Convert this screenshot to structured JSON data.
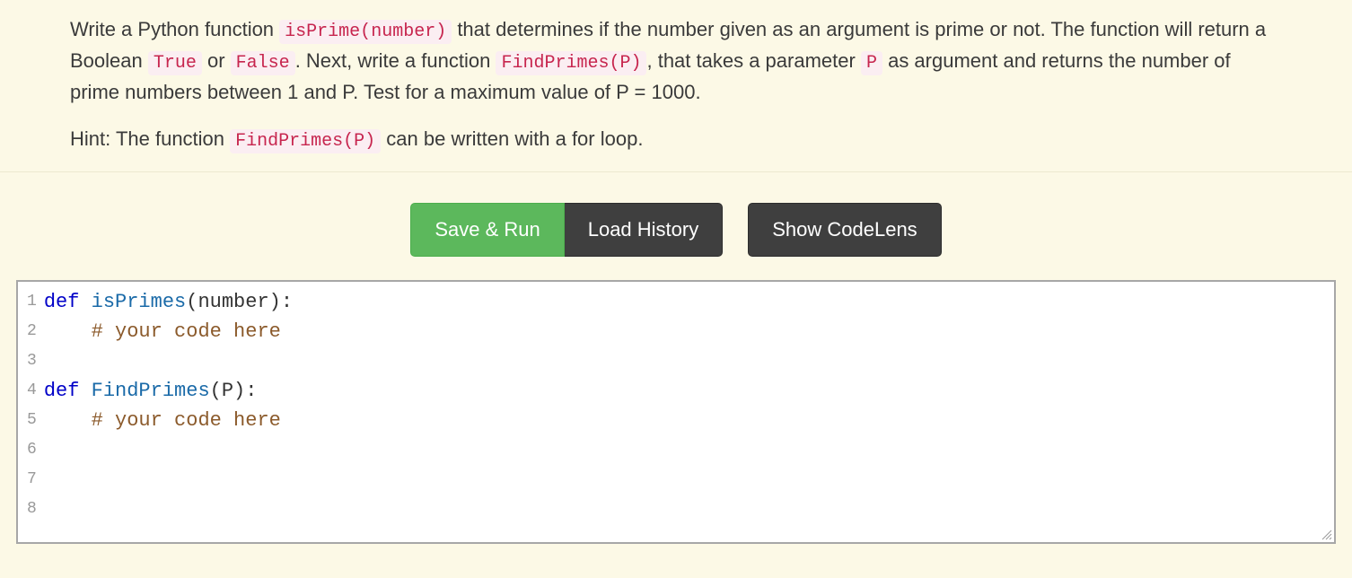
{
  "instructions": {
    "p1_parts": [
      {
        "t": "Write a Python function "
      },
      {
        "t": "isPrime(number)",
        "code": true
      },
      {
        "t": " that determines if the number given as an argument is prime or not. The function will return a Boolean "
      },
      {
        "t": "True",
        "code": true
      },
      {
        "t": " or "
      },
      {
        "t": "False",
        "code": true
      },
      {
        "t": ". Next, write a function "
      },
      {
        "t": "FindPrimes(P)",
        "code": true
      },
      {
        "t": ", that takes a parameter "
      },
      {
        "t": "P",
        "code": true
      },
      {
        "t": " as argument and returns the number of prime numbers between 1 and P. Test for a maximum value of P = 1000."
      }
    ],
    "p2_parts": [
      {
        "t": "Hint: The function "
      },
      {
        "t": "FindPrimes(P)",
        "code": true
      },
      {
        "t": " can be written with a for loop."
      }
    ]
  },
  "toolbar": {
    "save_run": "Save & Run",
    "load_history": "Load History",
    "show_codelens": "Show CodeLens"
  },
  "editor": {
    "line_numbers": [
      1,
      2,
      3,
      4,
      5,
      6,
      7,
      8
    ],
    "lines": [
      [
        {
          "t": "def ",
          "cls": "tok-kw"
        },
        {
          "t": "isPrimes",
          "cls": "tok-fn"
        },
        {
          "t": "(number):",
          "cls": ""
        }
      ],
      [
        {
          "t": "    # your code here",
          "cls": "tok-cm"
        }
      ],
      [
        {
          "t": "",
          "cls": ""
        }
      ],
      [
        {
          "t": "def ",
          "cls": "tok-kw"
        },
        {
          "t": "FindPrimes",
          "cls": "tok-fn"
        },
        {
          "t": "(P):",
          "cls": ""
        }
      ],
      [
        {
          "t": "    # your code here",
          "cls": "tok-cm"
        }
      ],
      [
        {
          "t": "",
          "cls": ""
        }
      ],
      [
        {
          "t": "",
          "cls": ""
        }
      ],
      [
        {
          "t": "",
          "cls": ""
        }
      ]
    ]
  }
}
